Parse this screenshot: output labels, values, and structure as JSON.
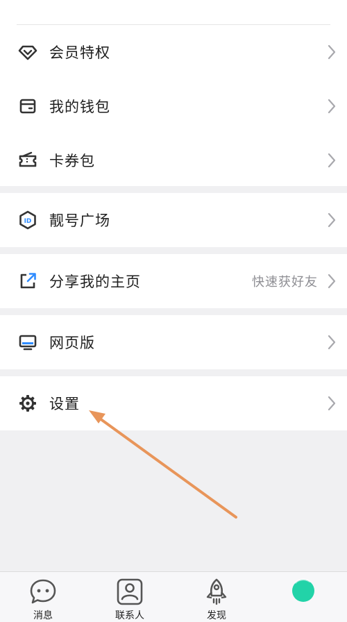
{
  "menu": {
    "items": [
      {
        "id": "vip",
        "label": "会员特权"
      },
      {
        "id": "wallet",
        "label": "我的钱包"
      },
      {
        "id": "coupon",
        "label": "卡券包"
      },
      {
        "id": "pretty-id",
        "label": "靓号广场"
      },
      {
        "id": "share",
        "label": "分享我的主页",
        "hint": "快速获好友"
      },
      {
        "id": "web",
        "label": "网页版"
      },
      {
        "id": "settings",
        "label": "设置"
      }
    ]
  },
  "tabbar": {
    "tabs": [
      {
        "label": "消息"
      },
      {
        "label": "联系人"
      },
      {
        "label": "发现"
      },
      {
        "label": ""
      }
    ]
  },
  "colors": {
    "accent_arrow": "#e8955a",
    "icon_gray": "#333333",
    "share_icon_blue": "#2f8cff",
    "avatar_teal": "#22d3a8"
  }
}
